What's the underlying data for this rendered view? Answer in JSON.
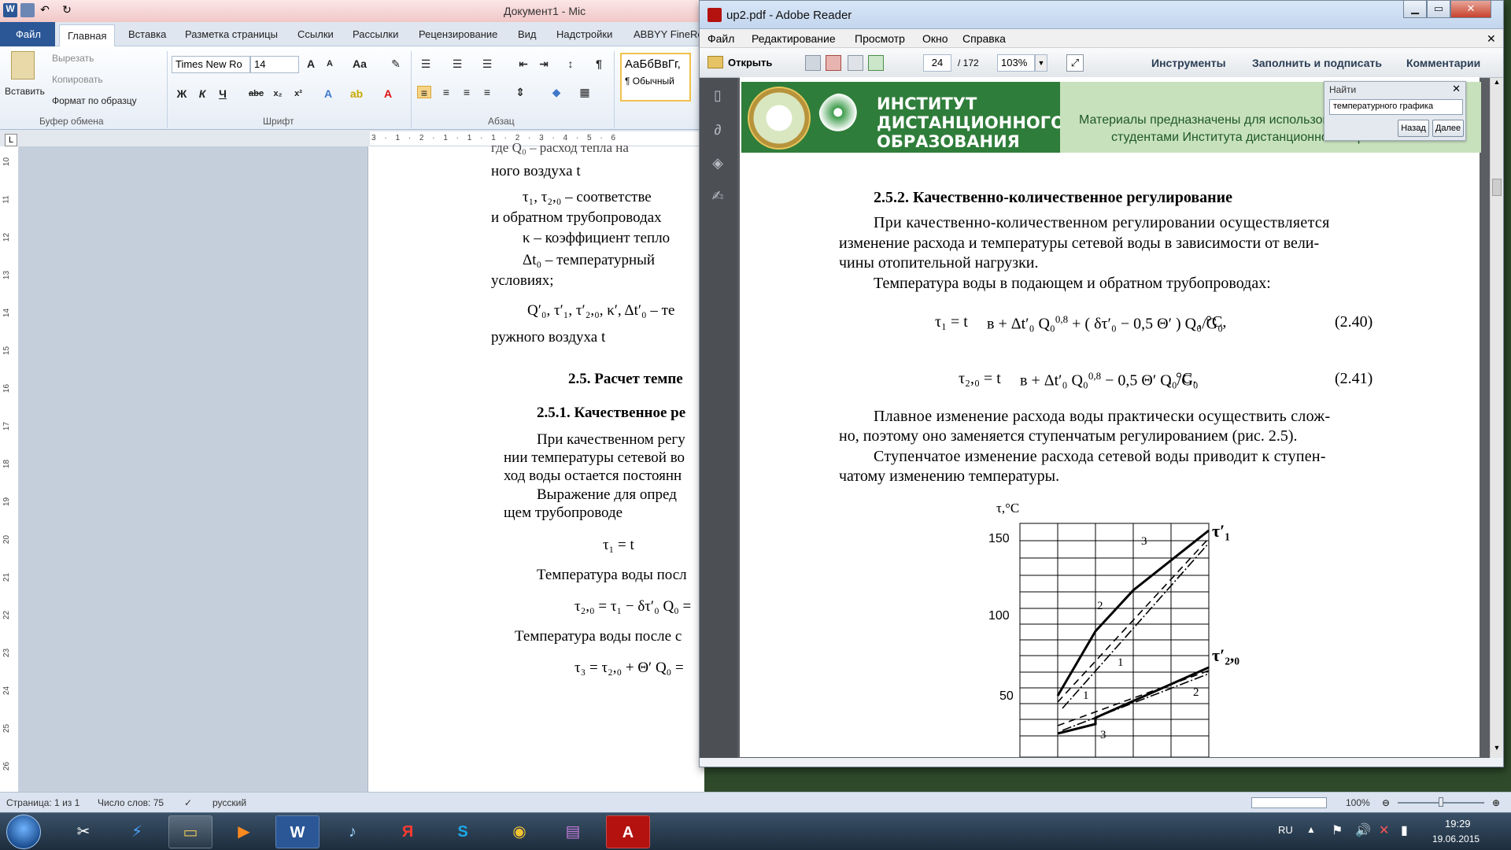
{
  "word": {
    "title": "Документ1 - Mic",
    "tabs": [
      "Файл",
      "Главная",
      "Вставка",
      "Разметка страницы",
      "Ссылки",
      "Рассылки",
      "Рецензирование",
      "Вид",
      "Надстройки",
      "ABBYY FineRe"
    ],
    "clipboard": {
      "paste": "Вставить",
      "cut": "Вырезать",
      "copy": "Копировать",
      "format_painter": "Формат по образцу",
      "group": "Буфер обмена"
    },
    "font": {
      "name": "Times New Ro",
      "size": "14",
      "group": "Шрифт"
    },
    "paragraph": {
      "group": "Абзац"
    },
    "style_tile": {
      "sample": "АаБбВвГг,",
      "name": "¶ Обычный"
    },
    "ruler_marks": [
      "3",
      "·",
      "1",
      "·",
      "2",
      "·",
      "1",
      "·",
      "1",
      "·",
      "1",
      "·",
      "2",
      "·",
      "3",
      "·",
      "4",
      "·",
      "5",
      "·",
      "6"
    ],
    "left_ruler_marks": [
      "10",
      "11",
      "12",
      "13",
      "14",
      "15",
      "16",
      "17",
      "18",
      "19",
      "20",
      "21",
      "22",
      "23",
      "24",
      "25",
      "26"
    ],
    "doc_lines": [
      "ного воздуха t",
      "τ₁,  τ₂,₀ – соответстве",
      "и обратном трубопроводах",
      "κ – коэффициент тепло",
      "Δt₀ – температурный",
      "условиях;",
      "Q′₀, τ′₁, τ′₂,₀, κ′, Δt′₀ – те",
      "ружного воздуха t",
      "2.5. Расчет темпе",
      "2.5.1. Качественное ре",
      "При качественном регу",
      "нии температуры сетевой во",
      "ход воды остается постоянн",
      "Выражение для опред",
      "щем трубопроводе",
      "τ₁ = t",
      "Температура воды посл",
      "τ₂,₀ = τ₁ − δτ′₀ Q₀ =",
      "Температура воды после с",
      "τ₃ = τ₂,₀ + Θ′ Q₀ ="
    ],
    "status": {
      "page": "Страница: 1 из 1",
      "words": "Число слов: 75",
      "lang": "русский",
      "zoom": "100%"
    }
  },
  "adobe": {
    "title": "up2.pdf - Adobe Reader",
    "menu": [
      "Файл",
      "Редактирование",
      "Просмотр",
      "Окно",
      "Справка"
    ],
    "open_label": "Открыть",
    "page_current": "24",
    "page_total": "/ 172",
    "zoom": "103%",
    "links": [
      "Инструменты",
      "Заполнить и подписать",
      "Комментарии"
    ],
    "banner": {
      "name_lines": [
        "ИНСТИТУТ",
        "ДИСТАНЦИОННОГО",
        "ОБРАЗОВАНИЯ"
      ],
      "info_lines": [
        "Материалы предназначены для использования в учеб",
        "студентами Института дистанционного образования ТПУ"
      ]
    },
    "find": {
      "header": "Найти",
      "query": "температурного графика",
      "back": "Назад",
      "next": "Далее"
    },
    "content": {
      "heading": "2.5.2. Качественно-количественное регулирование",
      "p1": [
        "При качественно-количественном регулировании осуществляется",
        "изменение расхода и температуры сетевой воды в зависимости от вели-",
        "чины отопительной нагрузки."
      ],
      "p2": "Температура воды в подающем и обратном трубопроводах:",
      "eq1": {
        "lhs": "τ₁ = t",
        "unit": ", °C,",
        "num": "(2.40)"
      },
      "eq2": {
        "lhs": "τ₂,₀ = t",
        "unit": ", °C.",
        "num": "(2.41)"
      },
      "p3": [
        "Плавное изменение расхода воды практически осуществить слож-",
        "но, поэтому оно заменяется ступенчатым регулированием (рис. 2.5)."
      ],
      "p4": [
        "Ступенчатое изменение расхода сетевой воды приводит к ступен-",
        "чатому изменению температуры."
      ]
    },
    "graph": {
      "y_label": "τ,°C",
      "y_ticks": [
        "150",
        "100",
        "50"
      ],
      "curve_labels": [
        "τ′₁",
        "τ′₂,₀"
      ],
      "markers": [
        "3",
        "2",
        "1",
        "1",
        "2",
        "3"
      ]
    }
  },
  "taskbar": {
    "lang": "RU",
    "time": "19:29",
    "date": "19.06.2015"
  },
  "colors": {
    "word_file_tab": "#2b5797",
    "banner_green": "#2f7d3a",
    "banner_info": "#c8e1bd"
  }
}
